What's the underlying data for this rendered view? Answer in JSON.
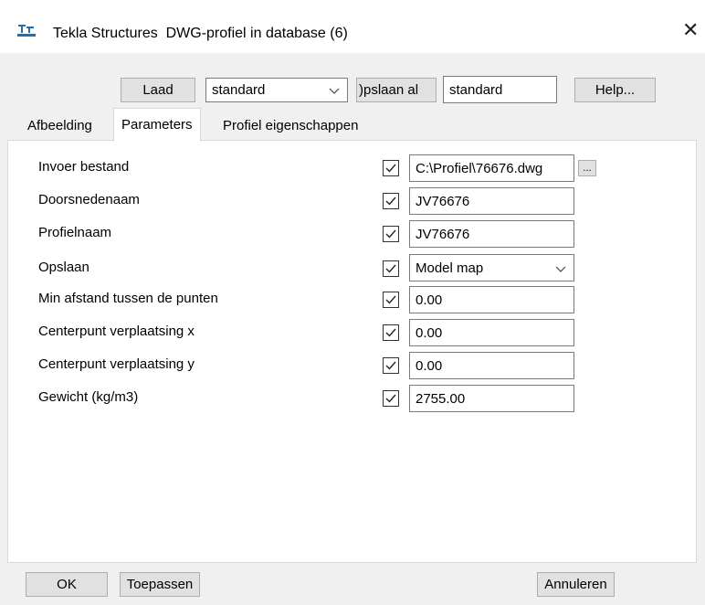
{
  "window": {
    "title": "Tekla Structures  DWG-profiel in database (6)",
    "close_glyph": "✕"
  },
  "toolbar": {
    "load_label": "Laad",
    "preset_value": "standard",
    "save_as_label": ")pslaan al",
    "save_as_name": "standard",
    "help_label": "Help..."
  },
  "tabs": [
    {
      "label": "Afbeelding",
      "active": false
    },
    {
      "label": "Parameters",
      "active": true
    },
    {
      "label": "Profiel eigenschappen",
      "active": false
    }
  ],
  "params": [
    {
      "label": "Invoer bestand",
      "checked": true,
      "value": "C:\\Profiel\\76676.dwg",
      "type": "file"
    },
    {
      "label": "Doorsnedenaam",
      "checked": true,
      "value": "JV76676",
      "type": "text"
    },
    {
      "label": "Profielnaam",
      "checked": true,
      "value": "JV76676",
      "type": "text"
    },
    {
      "label": "Opslaan",
      "checked": true,
      "value": "Model map",
      "type": "select"
    },
    {
      "label": "Min afstand tussen de punten",
      "checked": true,
      "value": "0.00",
      "type": "text"
    },
    {
      "label": "Centerpunt verplaatsing x",
      "checked": true,
      "value": "0.00",
      "type": "text"
    },
    {
      "label": "Centerpunt verplaatsing y",
      "checked": true,
      "value": "0.00",
      "type": "text"
    },
    {
      "label": "Gewicht (kg/m3)",
      "checked": true,
      "value": "2755.00",
      "type": "text"
    }
  ],
  "browse_label": "...",
  "footer": {
    "ok_label": "OK",
    "apply_label": "Toepassen",
    "cancel_label": "Annuleren"
  },
  "colors": {
    "app_icon": "#1b6fb5",
    "background": "#f0f0f0"
  },
  "icons": {
    "app": "tekla-logo-icon",
    "close": "close-icon",
    "dropdown": "chevron-down-icon",
    "check": "checkmark-icon"
  }
}
